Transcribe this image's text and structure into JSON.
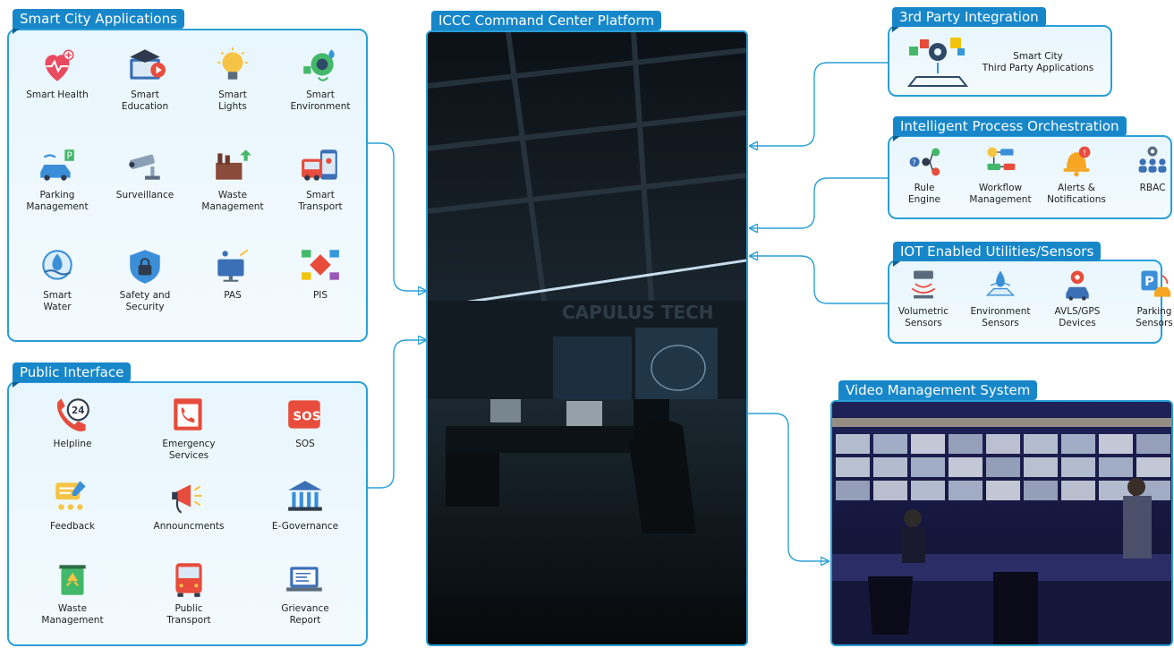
{
  "center": {
    "title": "ICCC Command Center Platform",
    "wall_text": "CAPULUS TECH"
  },
  "smart_city": {
    "title": "Smart City Applications",
    "items": [
      {
        "label": "Smart Health",
        "icon": "heart-health-icon"
      },
      {
        "label": "Smart\nEducation",
        "icon": "education-icon"
      },
      {
        "label": "Smart\nLights",
        "icon": "lightbulb-icon"
      },
      {
        "label": "Smart\nEnvironment",
        "icon": "environment-icon"
      },
      {
        "label": "Parking\nManagement",
        "icon": "parking-car-icon"
      },
      {
        "label": "Surveillance",
        "icon": "cctv-camera-icon"
      },
      {
        "label": "Waste\nManagement",
        "icon": "factory-recycle-icon"
      },
      {
        "label": "Smart\nTransport",
        "icon": "bus-map-icon"
      },
      {
        "label": "Smart\nWater",
        "icon": "water-drop-icon"
      },
      {
        "label": "Safety and\nSecurity",
        "icon": "shield-lock-icon"
      },
      {
        "label": "PAS",
        "icon": "monitor-broadcast-icon"
      },
      {
        "label": "PIS",
        "icon": "info-network-icon"
      }
    ]
  },
  "public_interface": {
    "title": "Public Interface",
    "items": [
      {
        "label": "Helpline",
        "icon": "phone-24-icon"
      },
      {
        "label": "Emergency\nServices",
        "icon": "emergency-phone-icon"
      },
      {
        "label": "SOS",
        "icon": "sos-icon",
        "text": "SOS"
      },
      {
        "label": "Feedback",
        "icon": "feedback-stars-icon"
      },
      {
        "label": "Announcments",
        "icon": "megaphone-icon"
      },
      {
        "label": "E-Governance",
        "icon": "government-building-icon"
      },
      {
        "label": "Waste\nManagement",
        "icon": "trash-bin-icon"
      },
      {
        "label": "Public\nTransport",
        "icon": "bus-icon"
      },
      {
        "label": "Grievance\nReport",
        "icon": "report-laptop-icon"
      }
    ]
  },
  "third_party": {
    "title": "3rd Party Integration",
    "text": "Smart City\nThird Party Applications",
    "icon": "integration-blocks-icon"
  },
  "orchestration": {
    "title": "Intelligent Process Orchestration",
    "items": [
      {
        "label": "Rule\nEngine",
        "icon": "rule-engine-icon"
      },
      {
        "label": "Workflow\nManagement",
        "icon": "workflow-icon"
      },
      {
        "label": "Alerts &\nNotifications",
        "icon": "bell-alert-icon"
      },
      {
        "label": "RBAC",
        "icon": "users-gear-icon"
      }
    ]
  },
  "iot": {
    "title": "IOT Enabled Utilities/Sensors",
    "items": [
      {
        "label": "Volumetric\nSensors",
        "icon": "volumetric-sensor-icon"
      },
      {
        "label": "Environment\nSensors",
        "icon": "environment-sensor-icon"
      },
      {
        "label": "AVLS/GPS\nDevices",
        "icon": "gps-vehicle-icon"
      },
      {
        "label": "Parking\nSensors",
        "icon": "parking-sensor-icon"
      }
    ]
  },
  "vms": {
    "title": "Video Management System"
  },
  "colors": {
    "accent": "#2a9fd6",
    "tag": "#1787c9"
  }
}
